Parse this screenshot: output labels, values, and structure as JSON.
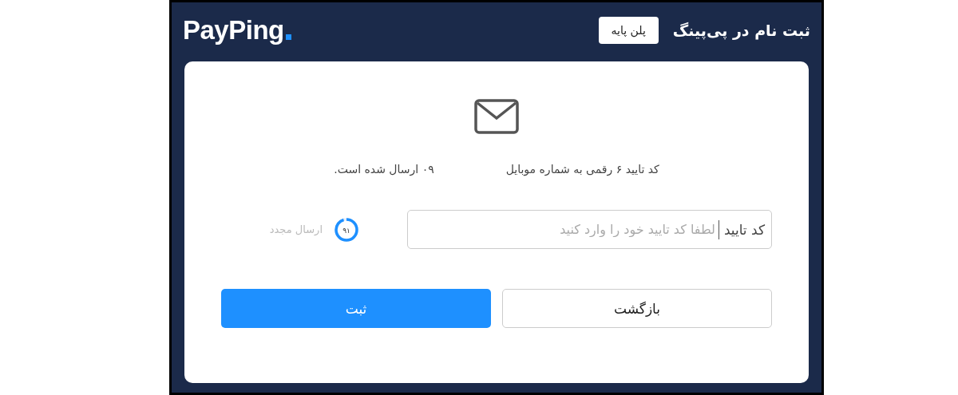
{
  "header": {
    "logo": "PayPing",
    "title": "ثبت نام در پی‌پینگ",
    "plan_button": "پلن پایه"
  },
  "message": {
    "part_1": "کد تایید ۶ رقمی به شماره موبایل",
    "part_2": "۰۹ ارسال شده است."
  },
  "code_field": {
    "label": "کد تایید",
    "placeholder": "لطفا کد تایید خود را وارد کنید"
  },
  "resend": {
    "timer": "۹۱",
    "level": 0.95,
    "label": "ارسال مجدد",
    "disabled": true
  },
  "buttons": [
    {
      "label": "بازگشت",
      "kind": "secondary"
    },
    {
      "label": "ثبت",
      "kind": "primary"
    }
  ]
}
